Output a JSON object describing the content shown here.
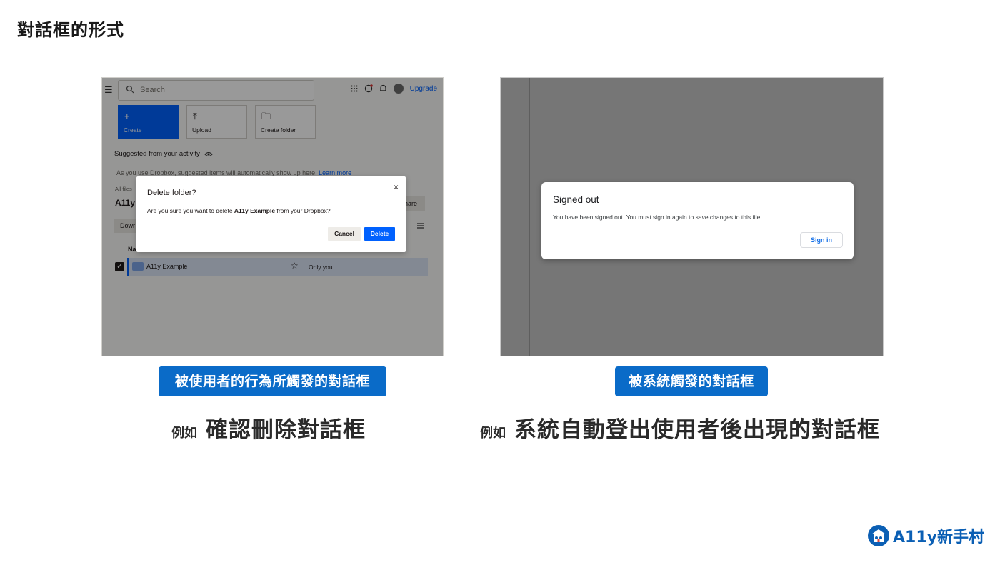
{
  "slide_title": "對話框的形式",
  "left": {
    "screenshot": {
      "search_placeholder": "Search",
      "upgrade": "Upgrade",
      "tiles": {
        "create": "Create",
        "upload": "Upload",
        "create_folder": "Create folder"
      },
      "suggested_label": "Suggested from your activity",
      "suggested_text": "As you use Dropbox, suggested items will automatically show up here.",
      "learn_more": "Learn more",
      "breadcrumb": "All files",
      "folder_title": "A11y",
      "share_label": "hare",
      "download_label": "Dowr",
      "col_name": "Na",
      "row": {
        "name": "A11y Example",
        "access": "Only you"
      },
      "dialog": {
        "title": "Delete folder?",
        "body_prefix": "Are you sure you want to delete ",
        "body_bold": "A11y Example",
        "body_suffix": " from your Dropbox?",
        "cancel": "Cancel",
        "delete": "Delete",
        "close_symbol": "×"
      }
    },
    "badge": "被使用者的行為所觸發的對話框",
    "example_prefix": "例如",
    "example_main": "確認刪除對話框"
  },
  "right": {
    "screenshot": {
      "dialog": {
        "title": "Signed out",
        "body": "You have been signed out. You must sign in again to save changes to this file.",
        "sign_in": "Sign in"
      }
    },
    "badge": "被系統觸發的對話框",
    "example_prefix": "例如",
    "example_main": "系統自動登出使用者後出現的對話框"
  },
  "brand": {
    "name": "A11y新手村"
  },
  "colors": {
    "badge_bg": "#0a6bc8",
    "dropbox_blue": "#0061fe",
    "brand_blue": "#0b5fb4"
  }
}
